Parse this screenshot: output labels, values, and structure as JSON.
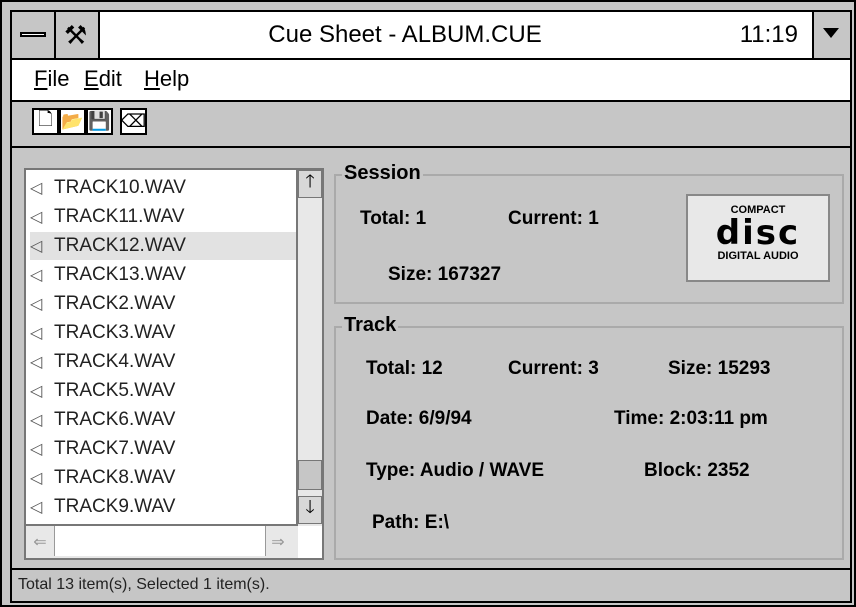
{
  "window": {
    "title": "Cue Sheet - ALBUM.CUE",
    "clock": "11:19"
  },
  "menu": [
    {
      "key": "F",
      "rest": "ile"
    },
    {
      "key": "E",
      "rest": "dit"
    },
    {
      "key": "H",
      "rest": "elp"
    }
  ],
  "toolbar": [
    {
      "name": "new-file-icon",
      "glyph": "🗋"
    },
    {
      "name": "open-folder-icon",
      "glyph": "📂"
    },
    {
      "name": "save-icon",
      "glyph": "💾"
    },
    {
      "name": "erase-icon",
      "glyph": "⌫"
    }
  ],
  "list": {
    "items": [
      "TRACK10.WAV",
      "TRACK11.WAV",
      "TRACK12.WAV",
      "TRACK13.WAV",
      "TRACK2.WAV",
      "TRACK3.WAV",
      "TRACK4.WAV",
      "TRACK5.WAV",
      "TRACK6.WAV",
      "TRACK7.WAV",
      "TRACK8.WAV",
      "TRACK9.WAV"
    ],
    "selected_index": 2
  },
  "session": {
    "label": "Session",
    "total": "Total: 1",
    "current": "Current: 1",
    "size": "Size: 167327",
    "logo_top": "COMPACT",
    "logo_main": "disc",
    "logo_bottom": "DIGITAL AUDIO"
  },
  "track": {
    "label": "Track",
    "total": "Total: 12",
    "current": "Current: 3",
    "size": "Size: 15293",
    "date": "Date: 6/9/94",
    "time": "Time: 2:03:11 pm",
    "type": "Type: Audio / WAVE",
    "block": "Block: 2352",
    "path": "Path: E:\\"
  },
  "status": "Total 13 item(s), Selected 1 item(s)."
}
